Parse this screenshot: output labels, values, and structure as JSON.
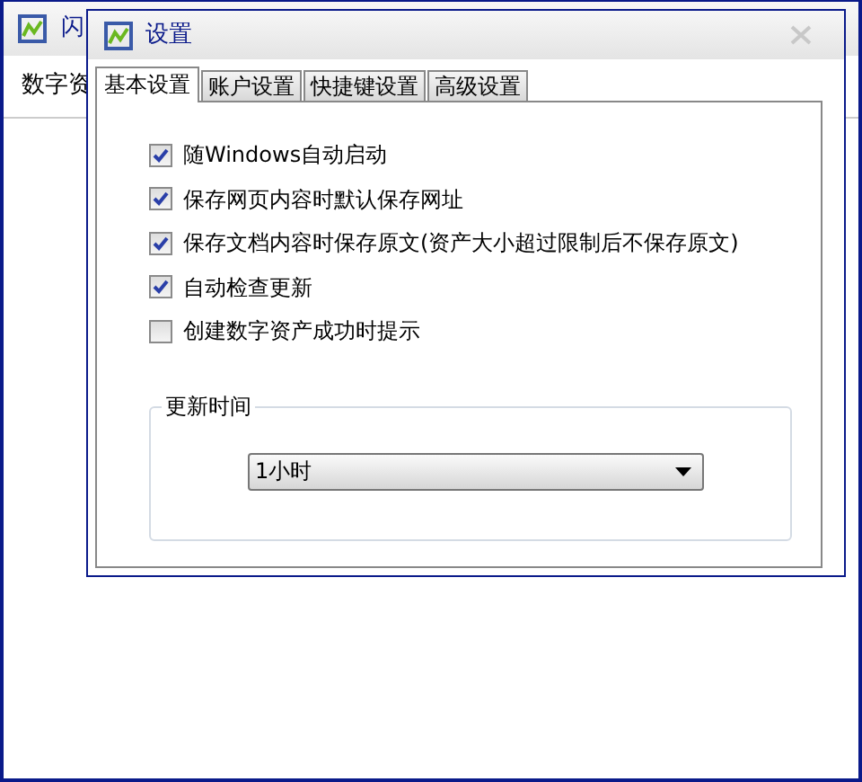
{
  "background_window": {
    "title": "闪",
    "toolbar_text": "数字资"
  },
  "dialog": {
    "title": "设置",
    "tabs": [
      {
        "label": "基本设置",
        "selected": true
      },
      {
        "label": "账户设置",
        "selected": false
      },
      {
        "label": "快捷键设置",
        "selected": false
      },
      {
        "label": "高级设置",
        "selected": false
      }
    ],
    "options": [
      {
        "label": "随Windows自动启动",
        "checked": true
      },
      {
        "label": "保存网页内容时默认保存网址",
        "checked": true
      },
      {
        "label": "保存文档内容时保存原文(资产大小超过限制后不保存原文)",
        "checked": true
      },
      {
        "label": "自动检查更新",
        "checked": true
      },
      {
        "label": "创建数字资产成功时提示",
        "checked": false
      }
    ],
    "update_group": {
      "title": "更新时间",
      "value": "1小时"
    }
  }
}
